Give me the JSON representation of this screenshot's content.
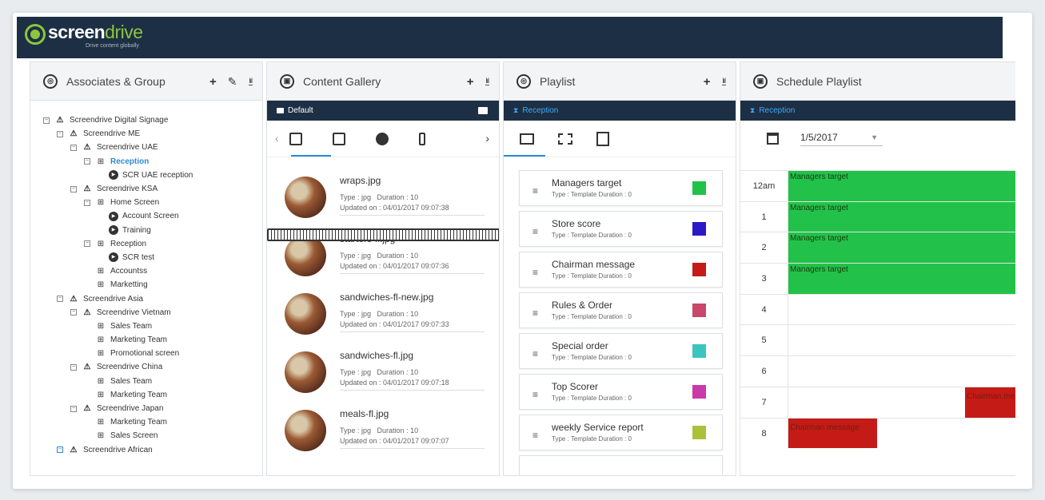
{
  "brand": {
    "name_bold": "screen",
    "name_light": "drive",
    "tagline": "Drive content globally",
    "accent": "#8cc63f"
  },
  "associates": {
    "title": "Associates & Group",
    "tree": [
      {
        "label": "Screendrive Digital Signage",
        "depth": 0,
        "kind": "org",
        "toggle": "⊟"
      },
      {
        "label": "Screendrive ME",
        "depth": 1,
        "kind": "org",
        "toggle": "⊟"
      },
      {
        "label": "Screendrive UAE",
        "depth": 2,
        "kind": "org",
        "toggle": "⊟"
      },
      {
        "label": "Reception",
        "depth": 3,
        "kind": "net",
        "toggle": "⊟",
        "selected": true
      },
      {
        "label": "SCR UAE reception",
        "depth": 4,
        "kind": "play"
      },
      {
        "label": "Screendrive KSA",
        "depth": 2,
        "kind": "org",
        "toggle": "⊟"
      },
      {
        "label": "Home Screen",
        "depth": 3,
        "kind": "net",
        "toggle": "⊟"
      },
      {
        "label": "Account Screen",
        "depth": 4,
        "kind": "play"
      },
      {
        "label": "Training",
        "depth": 4,
        "kind": "play"
      },
      {
        "label": "Reception",
        "depth": 3,
        "kind": "net",
        "toggle": "⊟"
      },
      {
        "label": "SCR test",
        "depth": 4,
        "kind": "play"
      },
      {
        "label": "Accountss",
        "depth": 3,
        "kind": "net"
      },
      {
        "label": "Marketting",
        "depth": 3,
        "kind": "net"
      },
      {
        "label": "Screendrive Asia",
        "depth": 1,
        "kind": "org",
        "toggle": "⊟"
      },
      {
        "label": "Screendrive Vietnam",
        "depth": 2,
        "kind": "org",
        "toggle": "⊟"
      },
      {
        "label": "Sales Team",
        "depth": 3,
        "kind": "net"
      },
      {
        "label": "Marketing Team",
        "depth": 3,
        "kind": "net"
      },
      {
        "label": "Promotional screen",
        "depth": 3,
        "kind": "net"
      },
      {
        "label": "Screendrive China",
        "depth": 2,
        "kind": "org",
        "toggle": "⊟"
      },
      {
        "label": "Sales Team",
        "depth": 3,
        "kind": "net"
      },
      {
        "label": "Marketing Team",
        "depth": 3,
        "kind": "net"
      },
      {
        "label": "Screendrive Japan",
        "depth": 2,
        "kind": "org",
        "toggle": "⊟"
      },
      {
        "label": "Marketing Team",
        "depth": 3,
        "kind": "net"
      },
      {
        "label": "Sales Screen",
        "depth": 3,
        "kind": "net"
      },
      {
        "label": "Screendrive African",
        "depth": 1,
        "kind": "org",
        "toggle": "⊟",
        "last": true
      }
    ]
  },
  "gallery": {
    "title": "Content Gallery",
    "folder": "Default",
    "items": [
      {
        "name": "wraps.jpg",
        "type": "Type : jpg",
        "duration": "Duration : 10",
        "updated": "Updated on : 04/01/2017 09:07:38"
      },
      {
        "name": "starters-fl.jpg",
        "type": "Type : jpg",
        "duration": "Duration : 10",
        "updated": "Updated on : 04/01/2017 09:07:36"
      },
      {
        "name": "sandwiches-fl-new.jpg",
        "type": "Type : jpg",
        "duration": "Duration : 10",
        "updated": "Updated on : 04/01/2017 09:07:33"
      },
      {
        "name": "sandwiches-fl.jpg",
        "type": "Type : jpg",
        "duration": "Duration : 10",
        "updated": "Updated on : 04/01/2017 09:07:18"
      },
      {
        "name": "meals-fl.jpg",
        "type": "Type : jpg",
        "duration": "Duration : 10",
        "updated": "Updated on : 04/01/2017 09:07:07"
      }
    ]
  },
  "playlist": {
    "title": "Playlist",
    "group": "Reception",
    "items": [
      {
        "name": "Managers target",
        "meta": "Type : Template Duration : 0",
        "color": "#22c24a"
      },
      {
        "name": "Store score",
        "meta": "Type : Template Duration : 0",
        "color": "#2a19c4"
      },
      {
        "name": "Chairman message",
        "meta": "Type : Template Duration : 0",
        "color": "#c41b17"
      },
      {
        "name": "Rules & Order",
        "meta": "Type : Template Duration : 0",
        "color": "#c9476a"
      },
      {
        "name": "Special order",
        "meta": "Type : Template Duration : 0",
        "color": "#3cc5bf"
      },
      {
        "name": "Top Scorer",
        "meta": "Type : Template Duration : 0",
        "color": "#c93aa8"
      },
      {
        "name": "weekly Service report",
        "meta": "Type : Template Duration : 0",
        "color": "#a9c23a"
      }
    ]
  },
  "schedule": {
    "title": "Schedule Playlist",
    "group": "Reception",
    "date": "1/5/2017",
    "hours": [
      "12am",
      "1",
      "2",
      "3",
      "4",
      "5",
      "6",
      "7",
      "8"
    ],
    "events": [
      {
        "label": "Managers target",
        "hour": 0,
        "color": "#22c24a"
      },
      {
        "label": "Managers target",
        "hour": 1,
        "color": "#22c24a"
      },
      {
        "label": "Managers target",
        "hour": 2,
        "color": "#22c24a"
      },
      {
        "label": "Managers target",
        "hour": 3,
        "color": "#22c24a"
      },
      {
        "label": "Chairman message",
        "hour": 7,
        "color": "#c41b17",
        "column": "right"
      },
      {
        "label": "Chairman message",
        "hour": 8,
        "color": "#c41b17",
        "column": "left"
      }
    ]
  }
}
